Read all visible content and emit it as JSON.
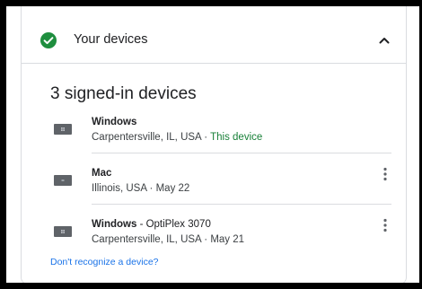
{
  "header": {
    "title": "Your devices",
    "status_icon": "check-circle-icon",
    "toggle_icon": "chevron-up-icon",
    "accent": "#1e8e3e"
  },
  "section": {
    "title": "3 signed-in devices"
  },
  "devices": [
    {
      "name": "Windows",
      "model": "",
      "location": "Carpentersville, IL, USA",
      "separator": " · ",
      "status": "This device",
      "has_menu": false
    },
    {
      "name": "Mac",
      "model": "",
      "location": "Illinois, USA",
      "separator": " · ",
      "status": "May 22",
      "has_menu": true
    },
    {
      "name": "Windows",
      "model": " - OptiPlex 3070",
      "location": "Carpentersville, IL, USA",
      "separator": " · ",
      "status": "May 21",
      "has_menu": true
    }
  ],
  "footer": {
    "link": "Don't recognize a device?"
  },
  "colors": {
    "link": "#1a73e8",
    "this_device": "#188038",
    "divider": "#dadce0"
  }
}
